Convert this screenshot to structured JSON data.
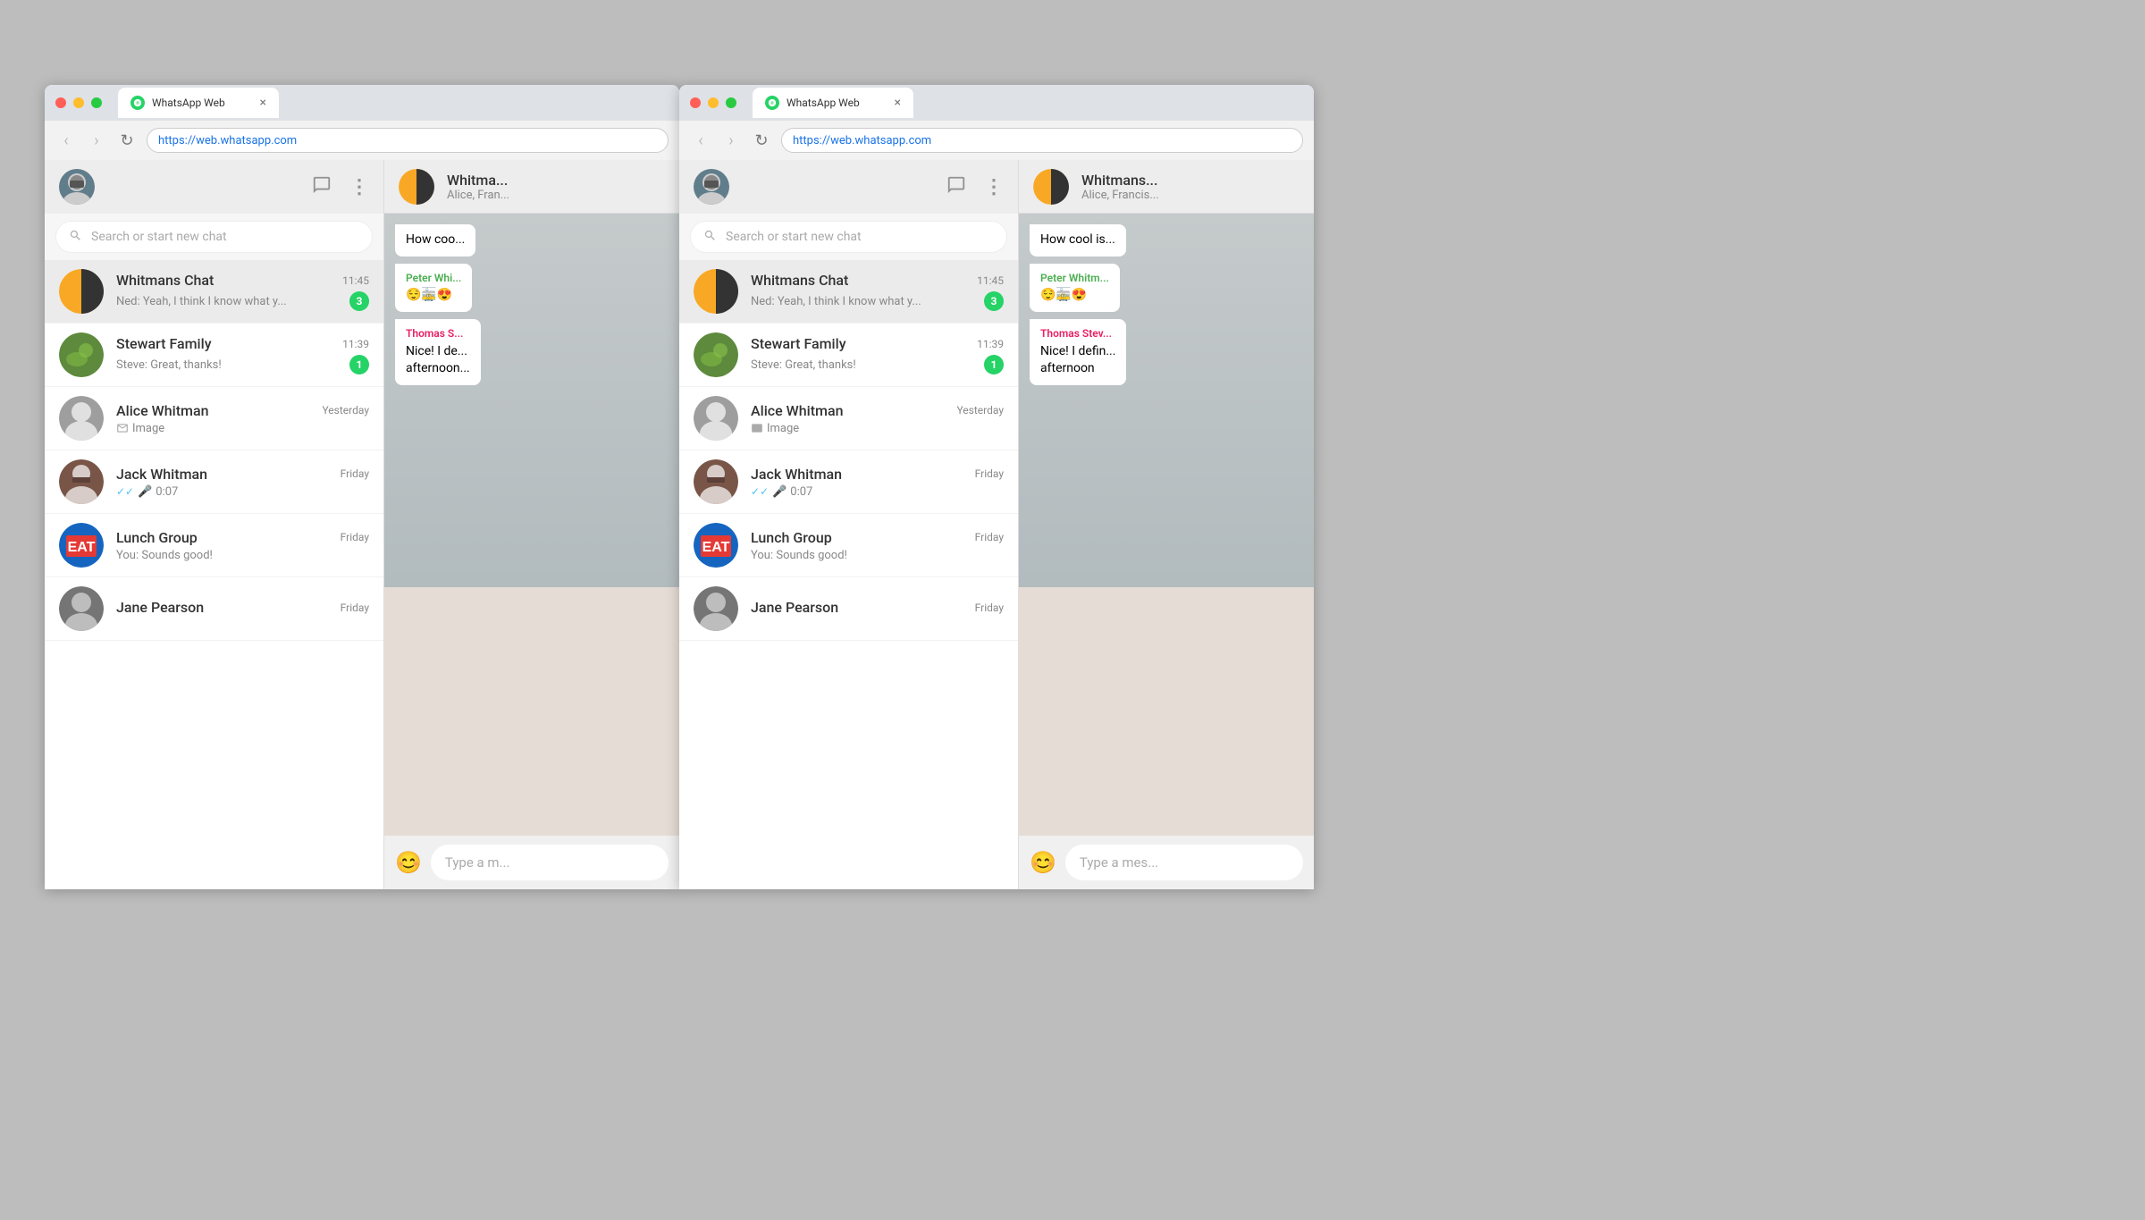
{
  "browsers": [
    {
      "id": "left",
      "tab_title": "WhatsApp Web",
      "url": "https://web.whatsapp.com",
      "nav_back_enabled": false,
      "nav_forward_enabled": false
    },
    {
      "id": "right",
      "tab_title": "WhatsApp Web",
      "url": "https://web.whatsapp.com",
      "nav_back_enabled": false,
      "nav_forward_enabled": false
    }
  ],
  "sidebar": {
    "search_placeholder": "Search or start new chat",
    "chats": [
      {
        "id": "whitmans",
        "name": "Whitmans Chat",
        "preview": "Ned: Yeah, I think I know what y...",
        "time": "11:45",
        "unread": 3,
        "selected": true,
        "avatar_type": "whitmans"
      },
      {
        "id": "stewart",
        "name": "Stewart Family",
        "preview": "Steve: Great, thanks!",
        "time": "11:39",
        "unread": 1,
        "selected": false,
        "avatar_type": "stewart"
      },
      {
        "id": "alice",
        "name": "Alice Whitman",
        "preview": "📷 Image",
        "time": "Yesterday",
        "unread": 0,
        "selected": false,
        "avatar_type": "alice"
      },
      {
        "id": "jack",
        "name": "Jack Whitman",
        "preview_voice": true,
        "preview_voice_text": "0:07",
        "time": "Friday",
        "unread": 0,
        "selected": false,
        "avatar_type": "jack"
      },
      {
        "id": "lunch",
        "name": "Lunch Group",
        "preview": "You: Sounds good!",
        "time": "Friday",
        "unread": 0,
        "selected": false,
        "avatar_type": "eat"
      },
      {
        "id": "jane",
        "name": "Jane Pearson",
        "preview": "",
        "time": "Friday",
        "unread": 0,
        "selected": false,
        "avatar_type": "jane"
      }
    ]
  },
  "chat_panel": {
    "name": "Whitma...",
    "subtitle": "Alice, Fran...",
    "messages": [
      {
        "type": "received",
        "text": "How cool is",
        "sender": null
      },
      {
        "type": "received",
        "text": "😌🚋😍",
        "sender": "Peter Whi...",
        "sender_color": "#4caf50"
      },
      {
        "type": "received",
        "text": "Nice! I definitely want to go this afternoon",
        "sender": "Thomas S...",
        "sender_color": "#e91e63"
      }
    ],
    "input_placeholder": "Type a mes..."
  },
  "icons": {
    "search": "🔍",
    "compose": "✏",
    "menu": "⋮",
    "emoji": "😊",
    "mic": "🎤",
    "double_tick": "✓✓"
  }
}
